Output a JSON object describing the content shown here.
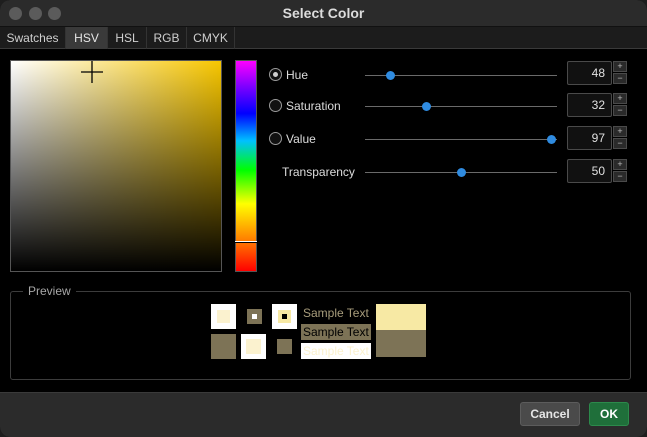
{
  "window": {
    "title": "Select Color"
  },
  "tabs": [
    {
      "label": "Swatches",
      "active": false
    },
    {
      "label": "HSV",
      "active": true
    },
    {
      "label": "HSL",
      "active": false
    },
    {
      "label": "RGB",
      "active": false
    },
    {
      "label": "CMYK",
      "active": false
    }
  ],
  "controls": [
    {
      "label": "Hue",
      "value": "48",
      "slider": 0.13,
      "radio": true,
      "checked": true
    },
    {
      "label": "Saturation",
      "value": "32",
      "slider": 0.32,
      "radio": true,
      "checked": false
    },
    {
      "label": "Value",
      "value": "97",
      "slider": 0.97,
      "radio": true,
      "checked": false
    },
    {
      "label": "Transparency",
      "value": "50",
      "slider": 0.5,
      "radio": false,
      "checked": false
    }
  ],
  "spin_up": "+",
  "spin_down": "−",
  "preview": {
    "legend": "Preview",
    "sample_text": "Sample Text"
  },
  "colors": {
    "selected": "#f7e9a4",
    "selected_dark": "#7d7356",
    "slider_accent": "#2f8be0",
    "ok_button": "#1f6f3a"
  },
  "footer": {
    "cancel_label": "Cancel",
    "ok_label": "OK"
  }
}
